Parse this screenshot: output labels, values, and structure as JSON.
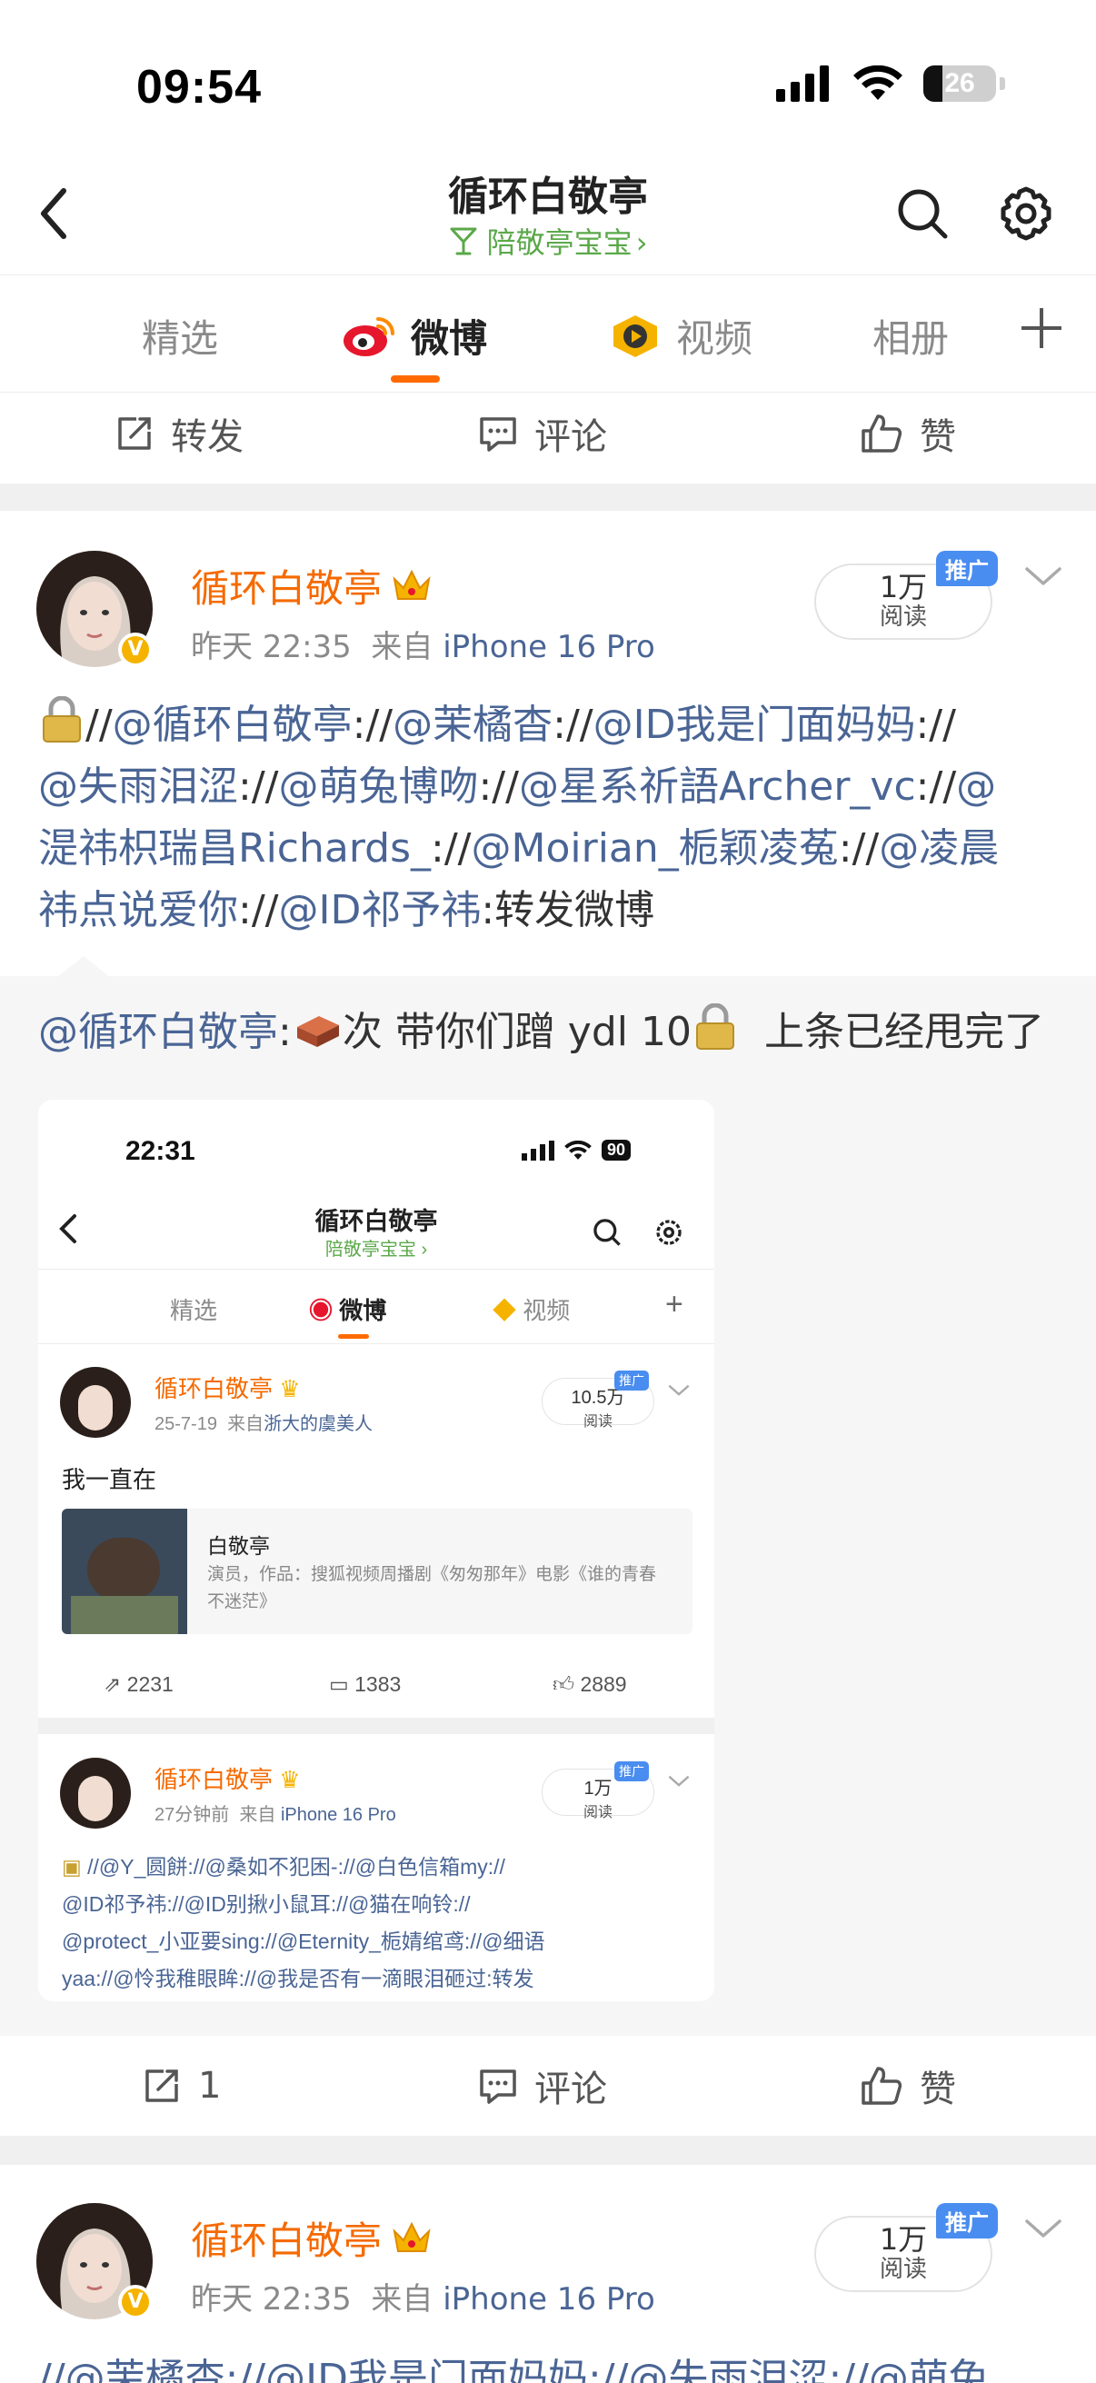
{
  "status": {
    "time": "09:54",
    "battery": "26",
    "battery_level": 0.26
  },
  "header": {
    "title": "循环白敬亭",
    "subtitle": "陪敬亭宝宝"
  },
  "tabs": [
    {
      "label": "精选"
    },
    {
      "label": "微博"
    },
    {
      "label": "视频"
    },
    {
      "label": "相册"
    }
  ],
  "top_actions": {
    "repost": "转发",
    "comment": "评论",
    "like": "赞"
  },
  "post1": {
    "author": "循环白敬亭",
    "time": "昨天 22:35",
    "from_label": "来自",
    "source": "iPhone 16 Pro",
    "reads": "1万",
    "reads_label": "阅读",
    "promo": "推广",
    "text_line1_a": "//",
    "text_line1_b": "@循环白敬亭",
    "text_line1_c": "://",
    "text_line1_d": "@茉橘杳",
    "text_line1_e": "://",
    "text_line1_f": "@ID我是门面妈妈",
    "text_line1_g": "://",
    "text_line2_a": "@失雨泪涩",
    "text_line2_b": "://",
    "text_line2_c": "@萌兔博吻",
    "text_line2_d": "://",
    "text_line2_e": "@星系祈語Archer_vc",
    "text_line2_f": "://",
    "text_line2_g": "@",
    "text_line3_a": "湜祎枳瑞昌Richards_",
    "text_line3_b": "://",
    "text_line3_c": "@Moirian_栀颖凌菟",
    "text_line3_d": "://",
    "text_line3_e": "@凌晨",
    "text_line4_a": "祎点说爱你",
    "text_line4_b": "://",
    "text_line4_c": "@ID祁予祎",
    "text_line4_d": ":转发微博",
    "retweet_mention": "@循环白敬亭",
    "retweet_text_a": ":",
    "retweet_text_b": "次 带你们蹭 ydl 10",
    "retweet_text_c": "上条已经甩完了",
    "actions": {
      "repost": "1",
      "comment": "评论",
      "like": "赞"
    }
  },
  "embedded": {
    "time": "22:31",
    "battery": "90",
    "title": "循环白敬亭",
    "subtitle": "陪敬亭宝宝",
    "tabs": [
      "精选",
      "微博",
      "视频"
    ],
    "post_a": {
      "author": "循环白敬亭",
      "date": "25-7-19",
      "from_label": "来自",
      "source": "浙大的虞美人",
      "reads": "10.5万",
      "reads_label": "阅读",
      "promo": "推广",
      "text": "我一直在",
      "card_title": "白敬亭",
      "card_desc": "演员，作品：搜狐视频周播剧《匆匆那年》电影《谁的青春不迷茫》",
      "reposts": "2231",
      "comments": "1383",
      "likes": "2889"
    },
    "post_b": {
      "author": "循环白敬亭",
      "time": "27分钟前",
      "from_label": "来自",
      "source": "iPhone 16 Pro",
      "reads": "1万",
      "reads_label": "阅读",
      "promo": "推广",
      "line1": "//@Y_圆餅://@桑如不犯困-://@白色信箱my://",
      "line2": "@ID祁予祎://@ID别揪小鼠耳://@猫在响铃://",
      "line3": "@protect_小亚要sing://@Eternity_栀婧绾鸢://@细语",
      "line4": "yaa://@怜我稚眼眸://@我是否有一滴眼泪砸过:转发"
    }
  },
  "post2": {
    "author": "循环白敬亭",
    "time": "昨天 22:35",
    "from_label": "来自",
    "source": "iPhone 16 Pro",
    "reads": "1万",
    "reads_label": "阅读",
    "promo": "推广",
    "text_partial": "//@茉橘杳://@ID我是门面妈妈://@失雨泪涩://@萌兔"
  },
  "colors": {
    "accent": "#ff6a00",
    "author": "#f56a00",
    "mention": "#4a6595",
    "green": "#5ba84a",
    "promo": "#4a8df0"
  }
}
